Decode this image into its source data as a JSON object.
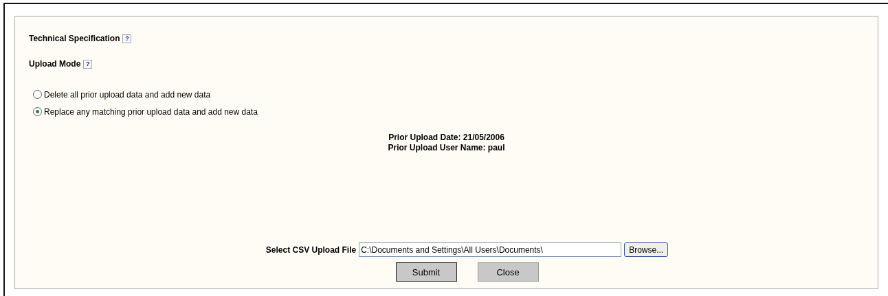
{
  "sections": [
    {
      "title": "Technical Specification",
      "help": "?"
    },
    {
      "title": "Upload Mode",
      "help": "?"
    }
  ],
  "upload_mode": [
    {
      "label": "Delete all prior upload data and add new data",
      "selected": false
    },
    {
      "label": "Replace any matching prior upload data and add new data",
      "selected": true
    }
  ],
  "prior_upload": [
    "Prior Upload Date: 21/05/2006",
    "Prior Upload User Name: paul"
  ],
  "file": {
    "label": "Select CSV Upload File",
    "value": "C:\\Documents and Settings\\All Users\\Documents\\",
    "browse": "Browse..."
  },
  "buttons": [
    {
      "label": "Submit",
      "kind": "default"
    },
    {
      "label": "Close",
      "kind": "plain"
    }
  ]
}
